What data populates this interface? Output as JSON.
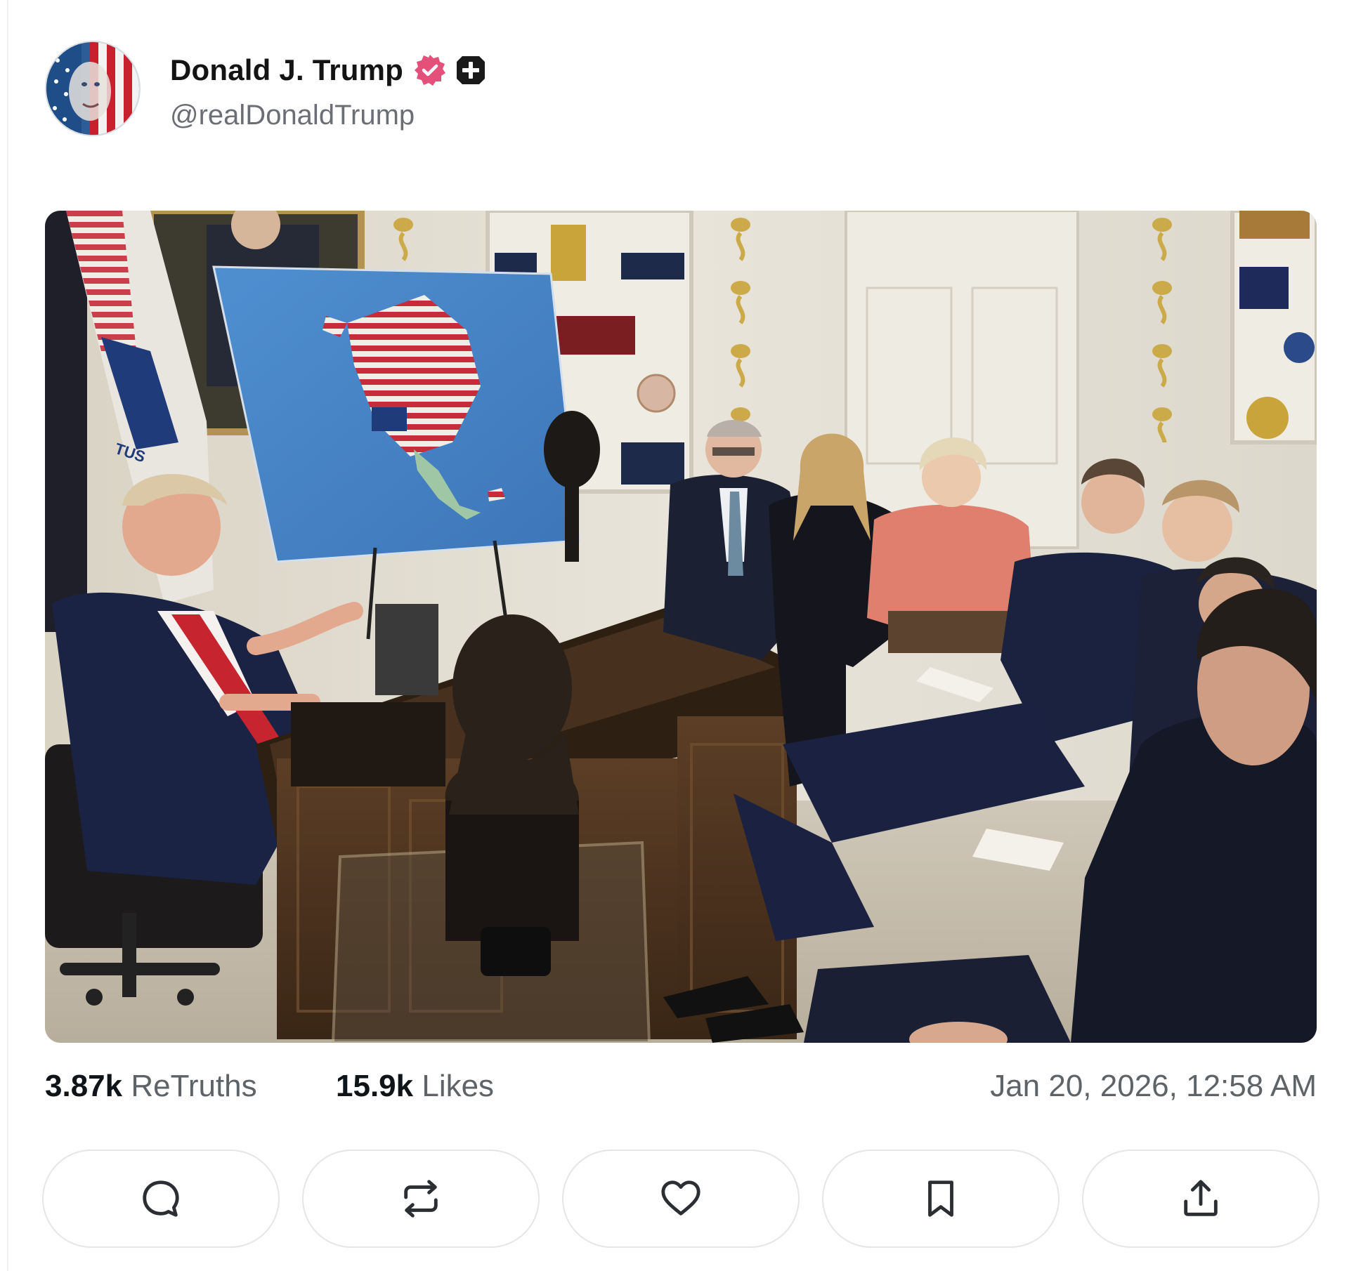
{
  "post": {
    "author_name": "Donald J. Trump",
    "author_handle": "@realDonaldTrump",
    "verified_badge_icon": "verified-badge-icon",
    "plus_badge_icon": "plus-badge-icon"
  },
  "media": {
    "type": "photo",
    "printed_text": "TUS"
  },
  "stats": {
    "retruths_count": "3.87k",
    "retruths_label": "ReTruths",
    "likes_count": "15.9k",
    "likes_label": "Likes",
    "timestamp": "Jan 20, 2026, 12:58 AM"
  },
  "actions": [
    {
      "icon": "reply-icon"
    },
    {
      "icon": "retruth-icon"
    },
    {
      "icon": "heart-icon"
    },
    {
      "icon": "bookmark-icon"
    },
    {
      "icon": "share-icon"
    }
  ],
  "colors": {
    "verified": "#e4507a",
    "text_primary": "#0f1419",
    "text_secondary": "#5e6368",
    "border": "#e4e6e8"
  }
}
